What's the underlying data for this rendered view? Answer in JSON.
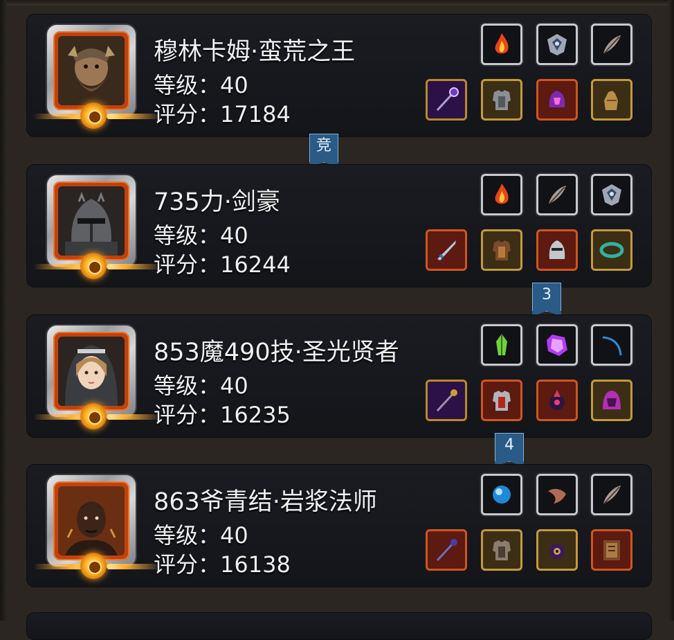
{
  "players": [
    {
      "name": "穆林卡姆·蛮荒之王",
      "level": "等级：40",
      "score": "评分：17184"
    },
    {
      "name": "735力·剑豪",
      "level": "等级：40",
      "score": "评分：16244"
    },
    {
      "name": "853魔490技·圣光贤者",
      "level": "等级：40",
      "score": "评分：16235"
    },
    {
      "name": "863爷青结·岩浆法师",
      "level": "等级：40",
      "score": "评分：16138"
    }
  ],
  "rank_tags": [
    "竞",
    "3",
    "4"
  ],
  "equipment": [
    {
      "top": [
        "fire-rune-icon",
        "silver-emblem-icon",
        "feather-quill-icon"
      ],
      "bottom": [
        "staff-weapon-icon",
        "chest-armor-icon",
        "purple-helm-icon",
        "gauntlet-icon"
      ]
    },
    {
      "top": [
        "fire-rune-icon",
        "feather-quill-icon",
        "silver-emblem-icon"
      ],
      "bottom": [
        "sword-weapon-icon",
        "chest-armor-icon",
        "knight-helm-icon",
        "green-bracer-icon"
      ]
    },
    {
      "top": [
        "green-crystal-icon",
        "purple-gem-icon",
        "blue-bow-icon"
      ],
      "bottom": [
        "staff-weapon-icon",
        "red-armor-icon",
        "dark-orb-icon",
        "pink-hood-icon"
      ]
    },
    {
      "top": [
        "blue-orb-icon",
        "horn-relic-icon",
        "feather-quill-icon"
      ],
      "bottom": [
        "staff-weapon-icon",
        "chest-armor-icon",
        "eye-charm-icon",
        "spellbook-icon"
      ]
    }
  ],
  "colors": {
    "card_bg": "#17181d",
    "avatar_frame": "#c2410c",
    "rank_tag": "#2a5a86",
    "text": "#eef0f2"
  }
}
